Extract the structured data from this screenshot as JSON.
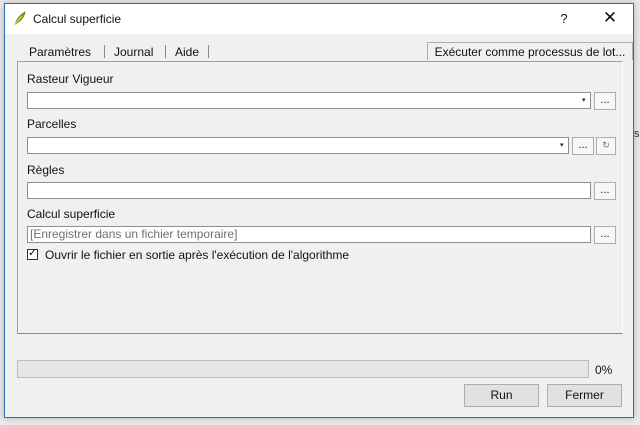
{
  "background_fragments": {
    "right_fragment": "si"
  },
  "window": {
    "title": "Calcul superficie",
    "help_glyph": "?",
    "close_glyph": "✕"
  },
  "tabs": [
    {
      "label": "Paramètres"
    },
    {
      "label": "Journal"
    },
    {
      "label": "Aide"
    }
  ],
  "batch_button": "Exécuter comme processus de lot...",
  "params": {
    "rasteur": {
      "label": "Rasteur Vigueur",
      "value": "",
      "browse": "..."
    },
    "parcelles": {
      "label": "Parcelles",
      "value": "",
      "browse": "..."
    },
    "regles": {
      "label": "Règles",
      "value": "",
      "browse": "..."
    },
    "output": {
      "label": "Calcul superficie",
      "placeholder": "[Enregistrer dans un fichier temporaire]",
      "browse": "..."
    },
    "open_output": {
      "label": "Ouvrir le fichier en sortie après l'exécution de l'algorithme",
      "checked": true
    }
  },
  "progress": {
    "value": 0,
    "text": "0%"
  },
  "buttons": {
    "run": "Run",
    "close": "Fermer"
  },
  "colors": {
    "accent_border": "#2b6fb6",
    "iterate_icon": "#3a9a3a"
  },
  "icons": {
    "app": "qgis-icon",
    "iterate": "iterate-icon"
  }
}
